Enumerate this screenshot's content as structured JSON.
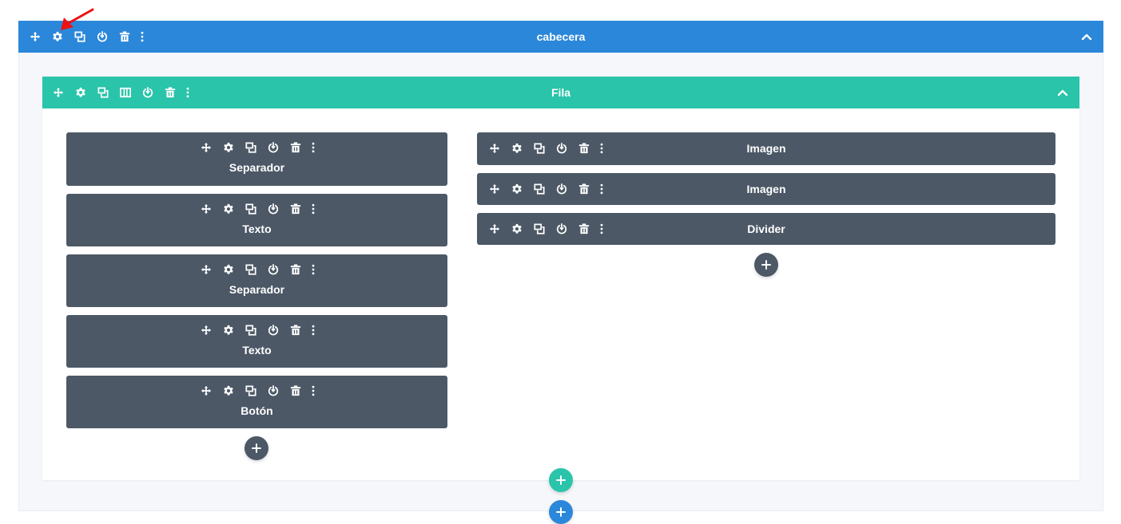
{
  "colors": {
    "section": "#2b87da",
    "row": "#29c4a9",
    "module": "#4c5866",
    "annotation_arrow": "#ee1111"
  },
  "section": {
    "title": "cabecera",
    "tools": [
      "move-icon",
      "gear-icon",
      "duplicate-icon",
      "power-icon",
      "trash-icon",
      "more-icon"
    ]
  },
  "row": {
    "title": "Fila",
    "tools": [
      "move-icon",
      "gear-icon",
      "duplicate-icon",
      "columns-icon",
      "power-icon",
      "trash-icon",
      "more-icon"
    ]
  },
  "columns": [
    {
      "modules": [
        {
          "label": "Separador"
        },
        {
          "label": "Texto"
        },
        {
          "label": "Separador"
        },
        {
          "label": "Texto"
        },
        {
          "label": "Botón"
        }
      ]
    },
    {
      "modules": [
        {
          "label": "Imagen"
        },
        {
          "label": "Imagen"
        },
        {
          "label": "Divider"
        }
      ]
    }
  ],
  "module_tools": [
    "move-icon",
    "gear-icon",
    "duplicate-icon",
    "power-icon",
    "trash-icon",
    "more-icon"
  ]
}
